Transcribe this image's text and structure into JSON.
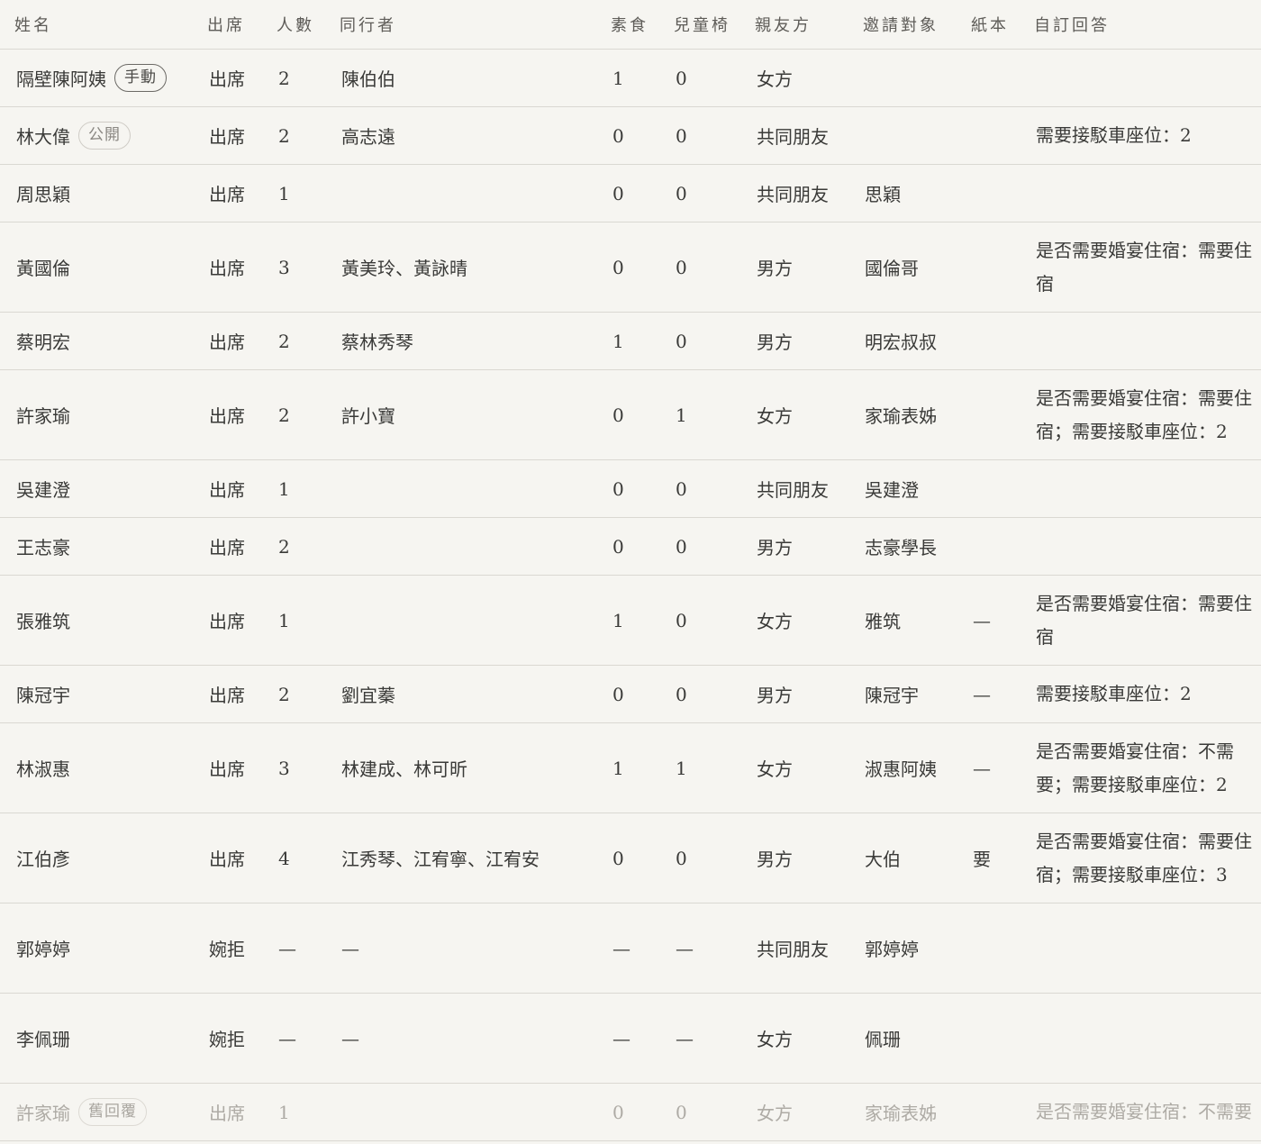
{
  "headers": [
    "姓名",
    "出席",
    "人數",
    "同行者",
    "素食",
    "兒童椅",
    "親友方",
    "邀請對象",
    "紙本",
    "自訂回答"
  ],
  "rows": [
    {
      "name": "隔壁陳阿姨",
      "tag": "手動",
      "attend": "出席",
      "count": "2",
      "companions": "陳伯伯",
      "veg": "1",
      "chair": "0",
      "side": "女方",
      "invitee": "",
      "paper": "",
      "custom": ""
    },
    {
      "name": "林大偉",
      "tag": "公開",
      "attend": "出席",
      "count": "2",
      "companions": "高志遠",
      "veg": "0",
      "chair": "0",
      "side": "共同朋友",
      "invitee": "",
      "paper": "",
      "custom": "需要接駁車座位：2"
    },
    {
      "name": "周思穎",
      "tag": "",
      "attend": "出席",
      "count": "1",
      "companions": "",
      "veg": "0",
      "chair": "0",
      "side": "共同朋友",
      "invitee": "思穎",
      "paper": "",
      "custom": ""
    },
    {
      "name": "黃國倫",
      "tag": "",
      "attend": "出席",
      "count": "3",
      "companions": "黃美玲、黃詠晴",
      "veg": "0",
      "chair": "0",
      "side": "男方",
      "invitee": "國倫哥",
      "paper": "",
      "custom": "是否需要婚宴住宿：需要住宿"
    },
    {
      "name": "蔡明宏",
      "tag": "",
      "attend": "出席",
      "count": "2",
      "companions": "蔡林秀琴",
      "veg": "1",
      "chair": "0",
      "side": "男方",
      "invitee": "明宏叔叔",
      "paper": "",
      "custom": ""
    },
    {
      "name": "許家瑜",
      "tag": "",
      "attend": "出席",
      "count": "2",
      "companions": "許小寶",
      "veg": "0",
      "chair": "1",
      "side": "女方",
      "invitee": "家瑜表姊",
      "paper": "",
      "custom": "是否需要婚宴住宿：需要住宿；需要接駁車座位：2"
    },
    {
      "name": "吳建澄",
      "tag": "",
      "attend": "出席",
      "count": "1",
      "companions": "",
      "veg": "0",
      "chair": "0",
      "side": "共同朋友",
      "invitee": "吳建澄",
      "paper": "",
      "custom": ""
    },
    {
      "name": "王志豪",
      "tag": "",
      "attend": "出席",
      "count": "2",
      "companions": "",
      "veg": "0",
      "chair": "0",
      "side": "男方",
      "invitee": "志豪學長",
      "paper": "",
      "custom": ""
    },
    {
      "name": "張雅筑",
      "tag": "",
      "attend": "出席",
      "count": "1",
      "companions": "",
      "veg": "1",
      "chair": "0",
      "side": "女方",
      "invitee": "雅筑",
      "paper": "—",
      "custom": "是否需要婚宴住宿：需要住宿"
    },
    {
      "name": "陳冠宇",
      "tag": "",
      "attend": "出席",
      "count": "2",
      "companions": "劉宜蓁",
      "veg": "0",
      "chair": "0",
      "side": "男方",
      "invitee": "陳冠宇",
      "paper": "—",
      "custom": "需要接駁車座位：2"
    },
    {
      "name": "林淑惠",
      "tag": "",
      "attend": "出席",
      "count": "3",
      "companions": "林建成、林可昕",
      "veg": "1",
      "chair": "1",
      "side": "女方",
      "invitee": "淑惠阿姨",
      "paper": "—",
      "custom": "是否需要婚宴住宿：不需要；需要接駁車座位：2"
    },
    {
      "name": "江伯彥",
      "tag": "",
      "attend": "出席",
      "count": "4",
      "companions": "江秀琴、江宥寧、江宥安",
      "veg": "0",
      "chair": "0",
      "side": "男方",
      "invitee": "大伯",
      "paper": "要",
      "custom": "是否需要婚宴住宿：需要住宿；需要接駁車座位：3"
    },
    {
      "name": "郭婷婷",
      "tag": "",
      "attend": "婉拒",
      "count": "—",
      "companions": "—",
      "veg": "—",
      "chair": "—",
      "side": "共同朋友",
      "invitee": "郭婷婷",
      "paper": "",
      "custom": ""
    },
    {
      "name": "李佩珊",
      "tag": "",
      "attend": "婉拒",
      "count": "—",
      "companions": "—",
      "veg": "—",
      "chair": "—",
      "side": "女方",
      "invitee": "佩珊",
      "paper": "",
      "custom": ""
    },
    {
      "name": "許家瑜",
      "tag": "舊回覆",
      "attend": "出席",
      "count": "1",
      "companions": "",
      "veg": "0",
      "chair": "0",
      "side": "女方",
      "invitee": "家瑜表姊",
      "paper": "",
      "custom": "是否需要婚宴住宿：不需要"
    }
  ]
}
